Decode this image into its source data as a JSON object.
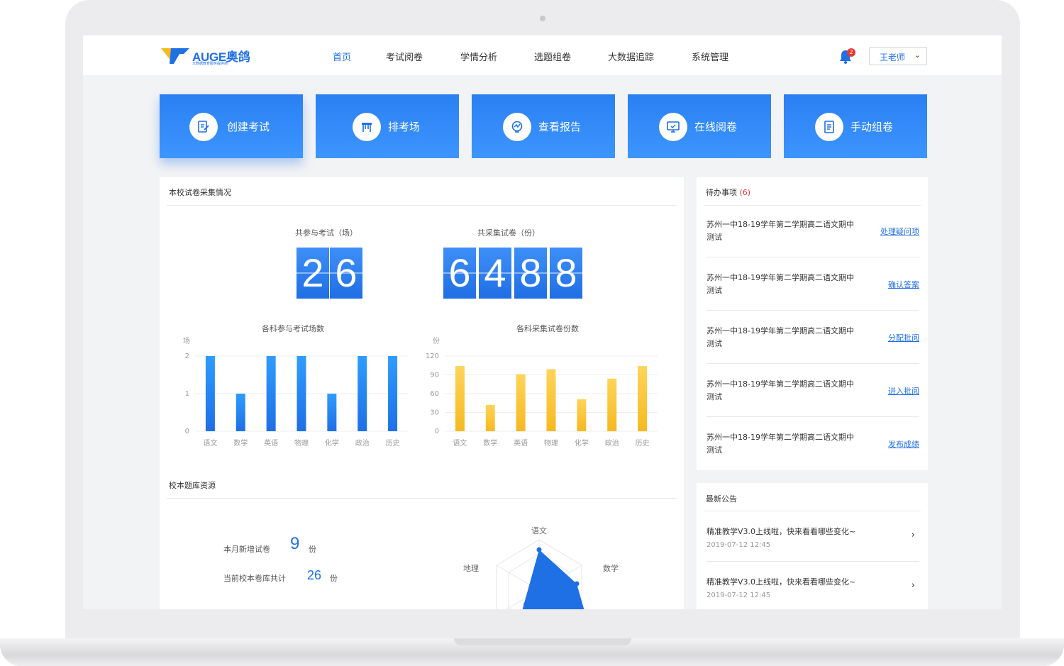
{
  "header": {
    "logo_text": "AUGE奥鸽",
    "logo_subtitle": "大数据教育服务提供商",
    "nav": [
      "首页",
      "考试阅卷",
      "学情分析",
      "选题组卷",
      "大数据追踪",
      "系统管理"
    ],
    "active_nav": "首页",
    "notification_count": "2",
    "user": "王老师"
  },
  "actions": [
    "创建考试",
    "排考场",
    "查看报告",
    "在线阅卷",
    "手动组卷"
  ],
  "collection": {
    "title": "本校试卷采集情况",
    "exams_label": "共参与考试（场）",
    "exams_digits": [
      "2",
      "6"
    ],
    "papers_label": "共采集试卷（份）",
    "papers_digits": [
      "6",
      "4",
      "8",
      "8"
    ]
  },
  "chart_data": [
    {
      "type": "bar",
      "title": "各科参与考试场数",
      "ylabel": "场",
      "categories": [
        "语文",
        "数学",
        "英语",
        "物理",
        "化学",
        "政治",
        "历史"
      ],
      "values": [
        2,
        1,
        2,
        2,
        1,
        2,
        2
      ],
      "ylim": [
        0,
        2
      ],
      "yticks": [
        0,
        1,
        2
      ],
      "color": "#1f6fe5",
      "grid": true
    },
    {
      "type": "bar",
      "title": "各科采集试卷份数",
      "ylabel": "份",
      "categories": [
        "语文",
        "数学",
        "英语",
        "物理",
        "化学",
        "政治",
        "历史"
      ],
      "values": [
        104,
        42,
        91,
        99,
        51,
        84,
        104
      ],
      "ylim": [
        0,
        120
      ],
      "yticks": [
        0,
        30,
        60,
        90,
        120
      ],
      "color": "#f5b920",
      "grid": true
    }
  ],
  "bank": {
    "title": "校本题库资源",
    "monthly_label": "本月新增试卷",
    "monthly_value": "9",
    "total_label": "当前校本卷库共计",
    "total_value": "26",
    "unit": "份",
    "radar_labels": [
      "语文",
      "数学",
      "地理"
    ]
  },
  "todo": {
    "title": "待办事项",
    "count": "(6)",
    "items": [
      {
        "text": "苏州一中18-19学年第二学期高二语文期中测试",
        "action": "处理疑问项"
      },
      {
        "text": "苏州一中18-19学年第二学期高二语文期中测试",
        "action": "确认答案"
      },
      {
        "text": "苏州一中18-19学年第二学期高二语文期中测试",
        "action": "分配批阅"
      },
      {
        "text": "苏州一中18-19学年第二学期高二语文期中测试",
        "action": "进入批阅"
      },
      {
        "text": "苏州一中18-19学年第二学期高二语文期中测试",
        "action": "发布成绩"
      }
    ]
  },
  "notices": {
    "title": "最新公告",
    "items": [
      {
        "text": "精准教学V3.0上线啦，快来看看哪些变化~",
        "date": "2019-07-12  12:45"
      },
      {
        "text": "精准教学V3.0上线啦，快来看看哪些变化~",
        "date": "2019-07-12  12:45"
      }
    ]
  }
}
